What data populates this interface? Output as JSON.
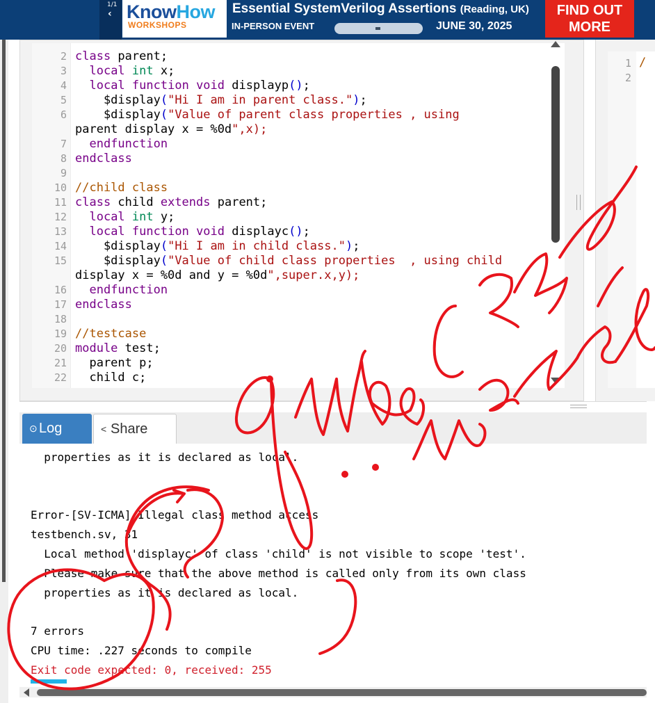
{
  "banner": {
    "slide_count": "1/1",
    "prev_glyph": "‹",
    "logo_know": "Know",
    "logo_how": "How",
    "logo_sub": "WORKSHOPS",
    "title_main": "Essential SystemVerilog Assertions",
    "title_loc": "(Reading, UK)",
    "event_kind": "IN-PERSON EVENT",
    "event_date": "JUNE 30, 2025",
    "cta_line1": "FIND OUT",
    "cta_line2": "MORE",
    "colors": {
      "banner_bg": "#0c3f77",
      "cta_bg": "#e4251b",
      "logo_blue": "#1b4f9b",
      "logo_cyan": "#27a7e0",
      "logo_orange": "#f07c1b"
    }
  },
  "editor": {
    "lines": [
      {
        "n": "2",
        "t": "class parent;"
      },
      {
        "n": "3",
        "t": "  local int x;"
      },
      {
        "n": "4",
        "t": "  local function void displayp();"
      },
      {
        "n": "5",
        "t": "    $display(\"Hi I am in parent class.\");"
      },
      {
        "n": "6",
        "t": "    $display(\"Value of parent class properties , using"
      },
      {
        "n": "",
        "t": "parent display x = %0d\",x);"
      },
      {
        "n": "7",
        "t": "  endfunction"
      },
      {
        "n": "8",
        "t": "endclass"
      },
      {
        "n": "9",
        "t": ""
      },
      {
        "n": "10",
        "t": "//child class"
      },
      {
        "n": "11",
        "t": "class child extends parent;"
      },
      {
        "n": "12",
        "t": "  local int y;"
      },
      {
        "n": "13",
        "t": "  local function void displayc();"
      },
      {
        "n": "14",
        "t": "    $display(\"Hi I am in child class.\");"
      },
      {
        "n": "15",
        "t": "    $display(\"Value of child class properties  , using child"
      },
      {
        "n": "",
        "t": "display x = %0d and y = %0d\",super.x,y);"
      },
      {
        "n": "16",
        "t": "  endfunction"
      },
      {
        "n": "17",
        "t": "endclass"
      },
      {
        "n": "18",
        "t": ""
      },
      {
        "n": "19",
        "t": "//testcase"
      },
      {
        "n": "20",
        "t": "module test;"
      },
      {
        "n": "21",
        "t": "  parent p;"
      },
      {
        "n": "22",
        "t": "  child c;"
      }
    ],
    "colors": {
      "keyword": "#770088",
      "type": "#008855",
      "string": "#aa1111",
      "comment": "#aa5500",
      "function": "#0000cc"
    }
  },
  "right_editor": {
    "line1": "1",
    "line2": "2",
    "comment_start": "/"
  },
  "tabs": {
    "log_icon": "play-circle-icon",
    "log_glyph": "⊙",
    "log_label": "Log",
    "share_icon": "share-icon",
    "share_glyph": "<",
    "share_label": "Share"
  },
  "log": {
    "lines": [
      {
        "t": "  properties as it is declared as local.",
        "err": false
      },
      {
        "t": "",
        "err": false
      },
      {
        "t": "",
        "err": false
      },
      {
        "t": "Error-[SV-ICMA] Illegal class method access",
        "err": false
      },
      {
        "t": "testbench.sv, 31",
        "err": false
      },
      {
        "t": "  Local method 'displayc' of class 'child' is not visible to scope 'test'.",
        "err": false
      },
      {
        "t": "  Please make sure that the above method is called only from its own class",
        "err": false
      },
      {
        "t": "  properties as it is declared as local.",
        "err": false
      },
      {
        "t": "",
        "err": false
      },
      {
        "t": "7 errors",
        "err": false
      },
      {
        "t": "CPU time: .227 seconds to compile",
        "err": false
      },
      {
        "t": "Exit code expected: 0, received: 255",
        "err": true
      }
    ],
    "colors": {
      "error_text": "#d0202c",
      "progress": "#1fb3e8",
      "log_tab": "#3a7fc1"
    }
  },
  "annotation": {
    "color": "#e8141c"
  }
}
